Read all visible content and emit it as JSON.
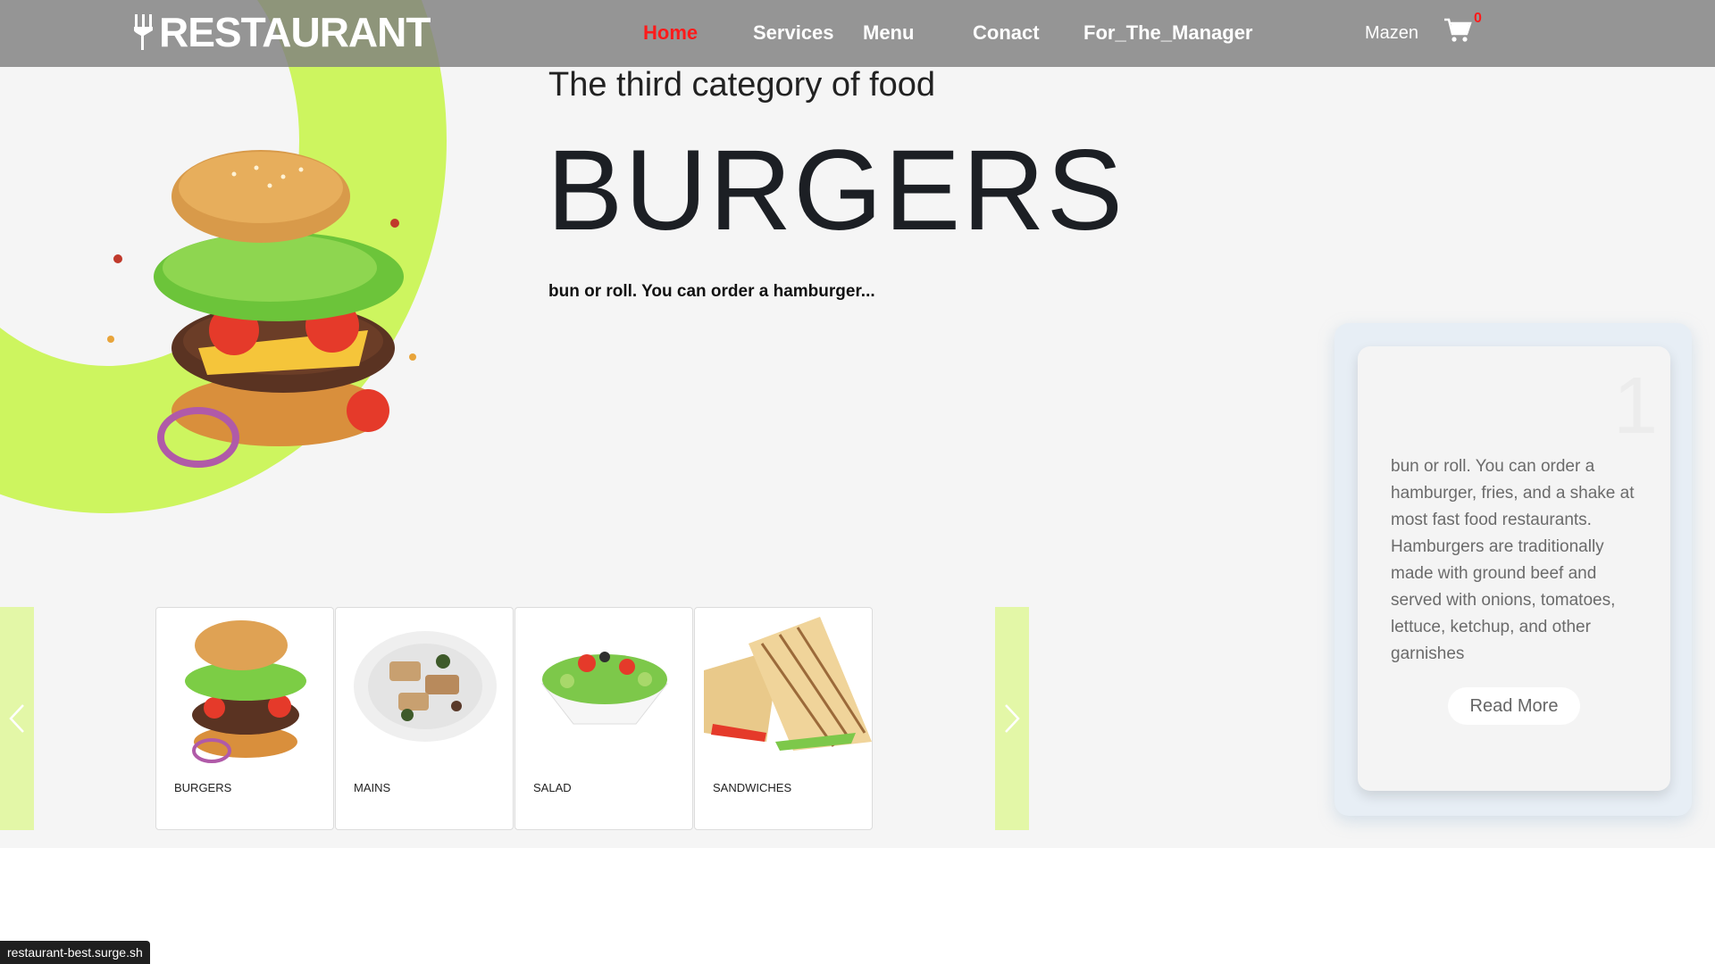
{
  "nav": {
    "logo_text": "RESTAURANT",
    "links": [
      "Home",
      "Services",
      "Menu",
      "Conact",
      "For_The_Manager"
    ],
    "active": "Home",
    "user": "Mazen",
    "cart_count": "0"
  },
  "hero": {
    "category": "The third category of food",
    "title": "BURGERS",
    "tagline": "bun or roll. You can order a hamburger..."
  },
  "slider": {
    "cards": [
      {
        "label": "BURGERS",
        "icon": "burger-image"
      },
      {
        "label": "MAINS",
        "icon": "grilled-dish-image"
      },
      {
        "label": "SALAD",
        "icon": "salad-image"
      },
      {
        "label": "SANDWICHES",
        "icon": "sandwich-image"
      }
    ]
  },
  "side_card": {
    "number": "1",
    "text": "bun or roll. You can order a hamburger, fries, and a shake at most fast food restaurants. Hamburgers are traditionally made with ground beef and served with onions, tomatoes, lettuce, ketchup, and other garnishes",
    "button": "Read More"
  },
  "status_bar": "restaurant-best.surge.sh",
  "colors": {
    "accent_green": "#cdf55f",
    "active_link": "#ff1a1a",
    "navbar": "#808080"
  }
}
